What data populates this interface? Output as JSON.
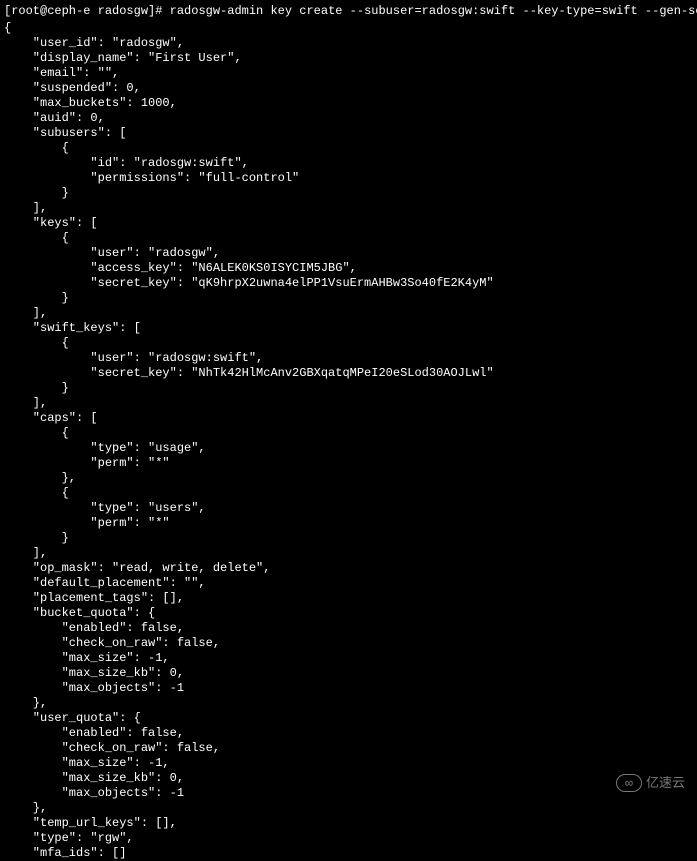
{
  "prompt": "[root@ceph-e radosgw]# ",
  "command": "radosgw-admin key create --subuser=radosgw:swift --key-type=swift --gen-secret",
  "output": {
    "user_id": "radosgw",
    "display_name": "First User",
    "email": "",
    "suspended": 0,
    "max_buckets": 1000,
    "auid": 0,
    "subusers": [
      {
        "id": "radosgw:swift",
        "permissions": "full-control"
      }
    ],
    "keys": [
      {
        "user": "radosgw",
        "access_key": "N6ALEK0KS0ISYCIM5JBG",
        "secret_key": "qK9hrpX2uwna4elPP1VsuErmAHBw3So40fE2K4yM"
      }
    ],
    "swift_keys": [
      {
        "user": "radosgw:swift",
        "secret_key": "NhTk42HlMcAnv2GBXqatqMPeI20eSLod30AOJLwl"
      }
    ],
    "caps": [
      {
        "type": "usage",
        "perm": "*"
      },
      {
        "type": "users",
        "perm": "*"
      }
    ],
    "op_mask": "read, write, delete",
    "default_placement": "",
    "placement_tags": [],
    "bucket_quota": {
      "enabled": false,
      "check_on_raw": false,
      "max_size": -1,
      "max_size_kb": 0,
      "max_objects": -1
    },
    "user_quota": {
      "enabled": false,
      "check_on_raw": false,
      "max_size": -1,
      "max_size_kb": 0,
      "max_objects": -1
    },
    "temp_url_keys": [],
    "type": "rgw",
    "mfa_ids": []
  },
  "watermark": "亿速云"
}
